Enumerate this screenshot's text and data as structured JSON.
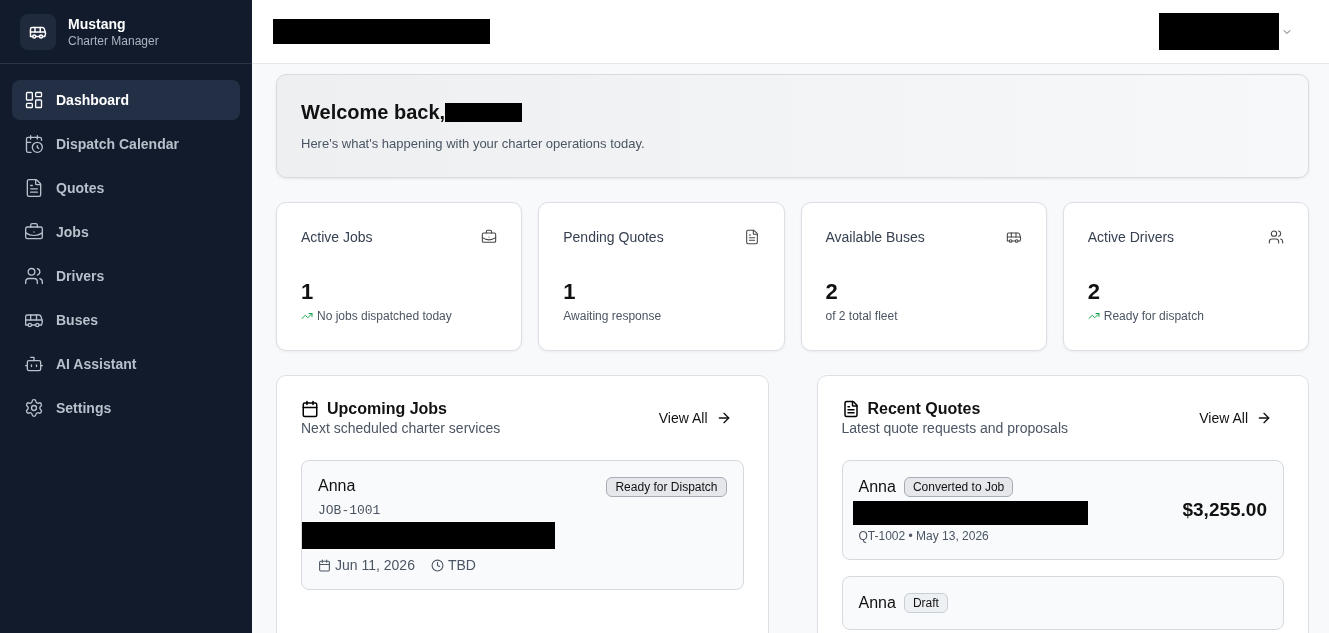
{
  "brand": {
    "name": "Mustang",
    "subtitle": "Charter Manager"
  },
  "sidebar": {
    "items": [
      {
        "label": "Dashboard",
        "kind": "dashboard",
        "selected": true
      },
      {
        "label": "Dispatch Calendar",
        "kind": "calendar",
        "selected": false
      },
      {
        "label": "Quotes",
        "kind": "quotes",
        "selected": false
      },
      {
        "label": "Jobs",
        "kind": "jobs",
        "selected": false
      },
      {
        "label": "Drivers",
        "kind": "drivers",
        "selected": false
      },
      {
        "label": "Buses",
        "kind": "buses",
        "selected": false
      },
      {
        "label": "AI Assistant",
        "kind": "assistant",
        "selected": false
      },
      {
        "label": "Settings",
        "kind": "settings",
        "selected": false
      }
    ]
  },
  "welcome": {
    "title": "Welcome back,",
    "subtitle": "Here's what's happening with your charter operations today."
  },
  "stats": [
    {
      "label": "Active Jobs",
      "kind": "jobs",
      "value": "1",
      "note": "No jobs dispatched today",
      "trend": true
    },
    {
      "label": "Pending Quotes",
      "kind": "quotes",
      "value": "1",
      "note": "Awaiting response",
      "trend": false
    },
    {
      "label": "Available Buses",
      "kind": "buses",
      "value": "2",
      "note": "of 2 total fleet",
      "trend": false
    },
    {
      "label": "Active Drivers",
      "kind": "drivers",
      "value": "2",
      "note": "Ready for dispatch",
      "trend": true
    }
  ],
  "upcoming_jobs": {
    "title": "Upcoming Jobs",
    "subtitle": "Next scheduled charter services",
    "view_all": "View All",
    "jobs": [
      {
        "customer": "Anna",
        "number": "JOB-1001",
        "status": "Ready for Dispatch",
        "date": "Jun 11, 2026",
        "time": "TBD"
      }
    ]
  },
  "recent_quotes": {
    "title": "Recent Quotes",
    "subtitle": "Latest quote requests and proposals",
    "view_all": "View All",
    "quotes": [
      {
        "customer": "Anna",
        "status": "Converted to Job",
        "meta": "QT-1002 • May 13, 2026",
        "amount": "$3,255.00"
      },
      {
        "customer": "Anna",
        "status": "Draft"
      }
    ]
  }
}
